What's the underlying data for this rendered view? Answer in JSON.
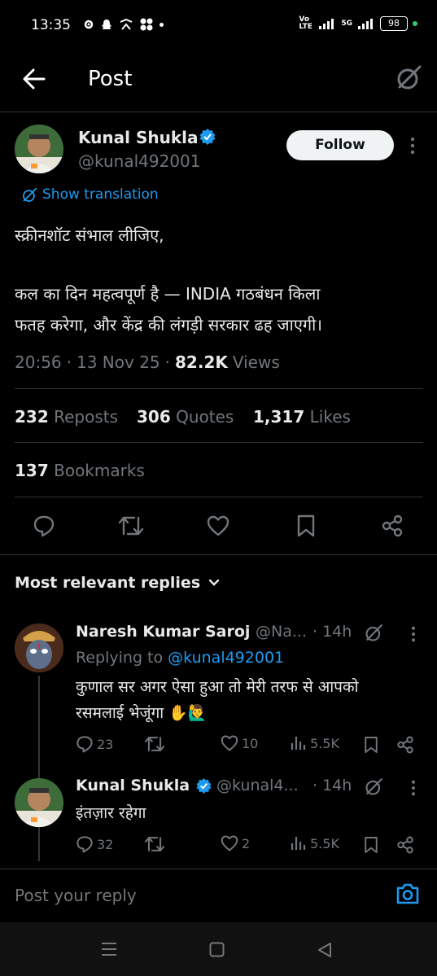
{
  "status_bar": {
    "time": "13:35",
    "network_text": "Vo LTE",
    "signal_text": "5G",
    "battery": "98"
  },
  "header": {
    "title": "Post"
  },
  "post": {
    "author_name": "Kunal Shukla",
    "author_handle": "@kunal492001",
    "follow_label": "Follow",
    "translate_label": "Show translation",
    "line1": "स्क्रीनशॉट संभाल लीजिए,",
    "line2": "कल का दिन महत्वपूर्ण है — INDIA गठबंधन किला",
    "line3": "फतह करेगा, और केंद्र की लंगड़ी सरकार ढह जाएगी।",
    "time": "20:56",
    "date": "13 Nov 25",
    "views_count": "82.2K",
    "views_label": "Views",
    "reposts_count": "232",
    "reposts_label": "Reposts",
    "quotes_count": "306",
    "quotes_label": "Quotes",
    "likes_count": "1,317",
    "likes_label": "Likes",
    "bookmarks_count": "137",
    "bookmarks_label": "Bookmarks"
  },
  "replies_header": {
    "label": "Most relevant replies"
  },
  "replies": [
    {
      "name": "Naresh Kumar Saroj",
      "handle": "@Na...",
      "time": "· 14h",
      "replying_prefix": "Replying to",
      "replying_handle": "@kunal492001",
      "line1": "कुणाल सर अगर ऐसा हुआ तो मेरी तरफ से आपको",
      "line2": "रसमलाई भेजूंगा ✋🙋‍♂️",
      "replies": "23",
      "likes": "10",
      "views": "5.5K"
    },
    {
      "name": "Kunal Shukla",
      "handle": "@kunal4...",
      "time": "· 14h",
      "line1": "इंतज़ार रहेगा",
      "replies": "32",
      "likes": "2",
      "views": "5.5K"
    }
  ],
  "reply_box": {
    "placeholder": "Post your reply"
  },
  "colors": {
    "accent": "#1d9bf0",
    "background": "#000000",
    "muted": "#71767b"
  }
}
